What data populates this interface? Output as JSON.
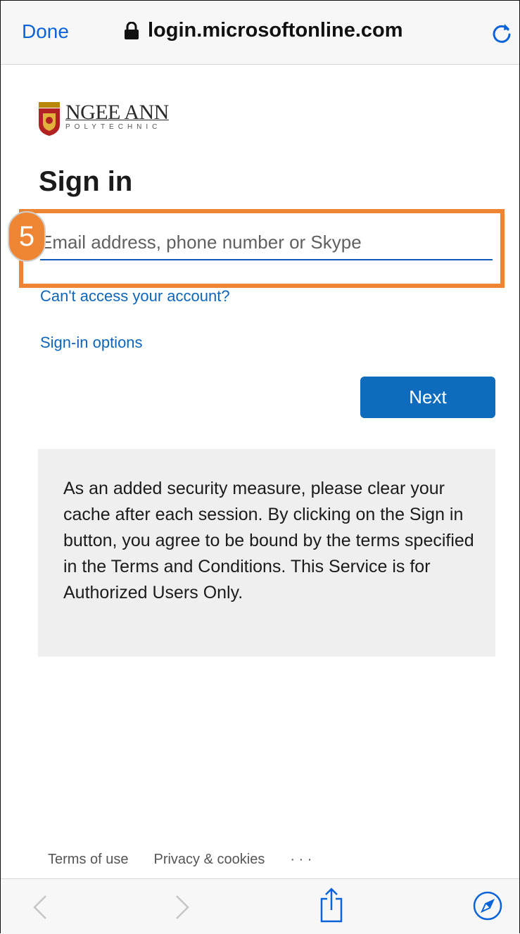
{
  "browser": {
    "done_label": "Done",
    "url": "login.microsoftonline.com",
    "accent_color": "#0a64d8"
  },
  "logo": {
    "name": "NGEE ANN",
    "subtitle": "POLYTECHNIC"
  },
  "signin": {
    "title": "Sign in",
    "email_placeholder": "Email address, phone number or Skype",
    "email_value": "",
    "cant_access_link": "Can't access your account?",
    "signin_options_link": "Sign-in options",
    "next_label": "Next",
    "button_color": "#0f6cbd"
  },
  "annotation": {
    "step_number": "5",
    "color": "#ee8533"
  },
  "notice": {
    "text": "As an added security measure, please clear your cache after each session. By clicking on the Sign in button, you agree to be bound by the terms specified in the Terms and Conditions. This Service is for Authorized Users Only."
  },
  "footer": {
    "terms": "Terms of use",
    "privacy": "Privacy & cookies",
    "more": "· · ·"
  },
  "toolbar": {
    "icons": [
      "back-icon",
      "forward-icon",
      "share-icon",
      "compass-icon"
    ]
  }
}
